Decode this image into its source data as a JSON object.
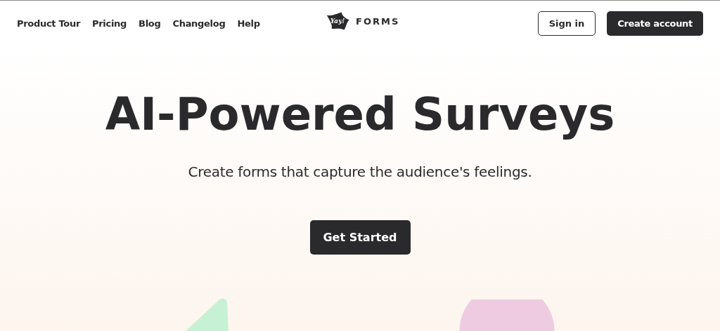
{
  "nav": {
    "links": [
      "Product Tour",
      "Pricing",
      "Blog",
      "Changelog",
      "Help"
    ],
    "logo": {
      "mark": "Yay!",
      "word": "FORMS"
    },
    "buttons": [
      {
        "label": "Sign in",
        "kind": "outline"
      },
      {
        "label": "Create account",
        "kind": "filled"
      }
    ]
  },
  "hero": {
    "title": "AI-Powered Surveys",
    "subtitle": "Create forms that capture the audience's feelings.",
    "cta": "Get Started"
  }
}
